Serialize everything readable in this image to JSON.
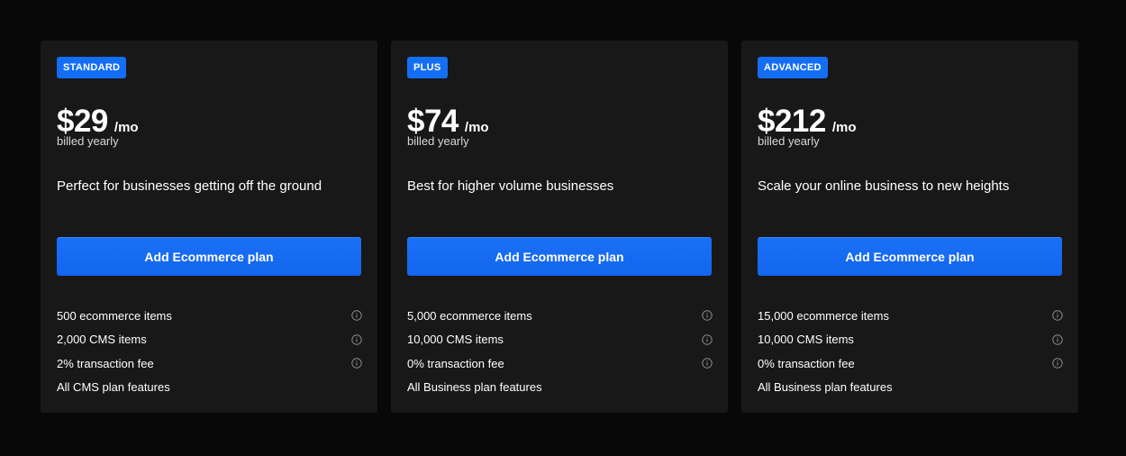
{
  "plans": [
    {
      "badge": "STANDARD",
      "price": "$29",
      "period": "/mo",
      "billing": "billed yearly",
      "description": "Perfect for businesses getting off the ground",
      "cta": "Add Ecommerce plan",
      "features": [
        {
          "text": "500 ecommerce items",
          "info": true
        },
        {
          "text": "2,000 CMS items",
          "info": true
        },
        {
          "text": "2% transaction fee",
          "info": true
        },
        {
          "text": "All CMS plan features",
          "info": false
        }
      ]
    },
    {
      "badge": "PLUS",
      "price": "$74",
      "period": "/mo",
      "billing": "billed yearly",
      "description": "Best for higher volume businesses",
      "cta": "Add Ecommerce plan",
      "features": [
        {
          "text": "5,000 ecommerce items",
          "info": true
        },
        {
          "text": "10,000 CMS items",
          "info": true
        },
        {
          "text": "0% transaction fee",
          "info": true
        },
        {
          "text": "All Business plan features",
          "info": false
        }
      ]
    },
    {
      "badge": "ADVANCED",
      "price": "$212",
      "period": "/mo",
      "billing": "billed yearly",
      "description": "Scale your online business to new heights",
      "cta": "Add Ecommerce plan",
      "features": [
        {
          "text": "15,000 ecommerce items",
          "info": true
        },
        {
          "text": "10,000 CMS items",
          "info": true
        },
        {
          "text": "0% transaction fee",
          "info": true
        },
        {
          "text": "All Business plan features",
          "info": false
        }
      ]
    }
  ],
  "icons": {
    "info": "info-circle-icon"
  },
  "colors": {
    "background": "#080808",
    "card": "#181818",
    "accent": "#146ef5",
    "muted_icon": "#8a8a8a"
  }
}
